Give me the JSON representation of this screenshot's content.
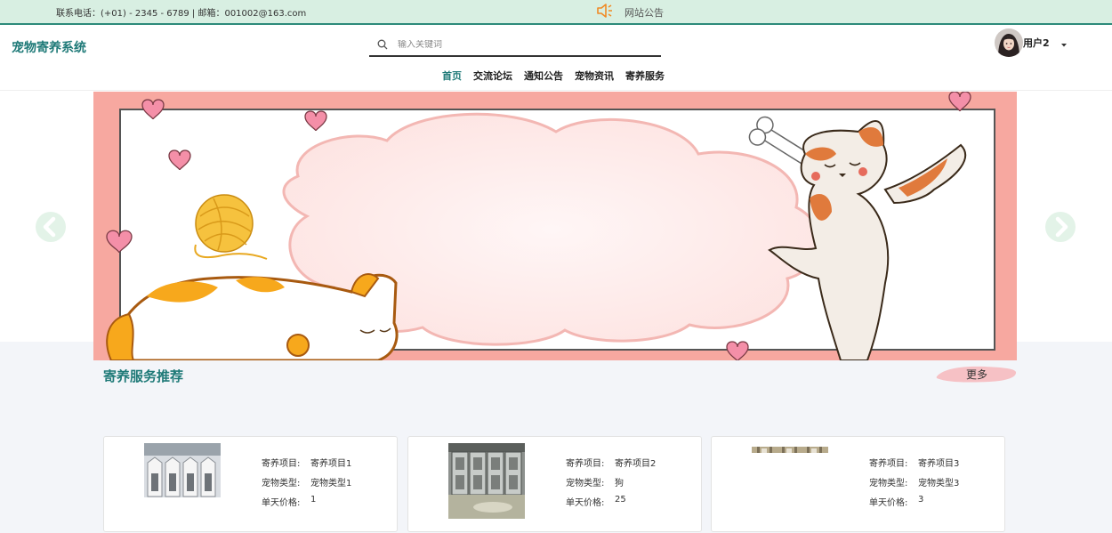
{
  "topbar": {
    "contact": "联系电话：(+01) - 2345 - 6789 | 邮箱：001002@163.com",
    "notice_label": "网站公告"
  },
  "header": {
    "site_title": "宠物寄养系统",
    "search_placeholder": "输入关键词",
    "username": "用户2",
    "nav": [
      {
        "label": "首页",
        "active": true
      },
      {
        "label": "交流论坛"
      },
      {
        "label": "通知公告"
      },
      {
        "label": "宠物资讯"
      },
      {
        "label": "寄养服务"
      }
    ]
  },
  "section": {
    "title": "寄养服务推荐",
    "more_label": "更多"
  },
  "cards": [
    {
      "k1": "寄养项目:",
      "v1": "寄养项目1",
      "k2": "宠物类型:",
      "v2": "宠物类型1",
      "k3": "单天价格:",
      "v3": "1"
    },
    {
      "k1": "寄养项目:",
      "v1": "寄养项目2",
      "k2": "宠物类型:",
      "v2": "狗",
      "k3": "单天价格:",
      "v3": "25"
    },
    {
      "k1": "寄养项目:",
      "v1": "寄养项目3",
      "k2": "宠物类型:",
      "v2": "宠物类型3",
      "k3": "单天价格:",
      "v3": "3"
    }
  ],
  "colors": {
    "accent": "#1f7a78",
    "topbar_bg": "#d8efe2",
    "banner_frame": "#f7a8a0"
  }
}
